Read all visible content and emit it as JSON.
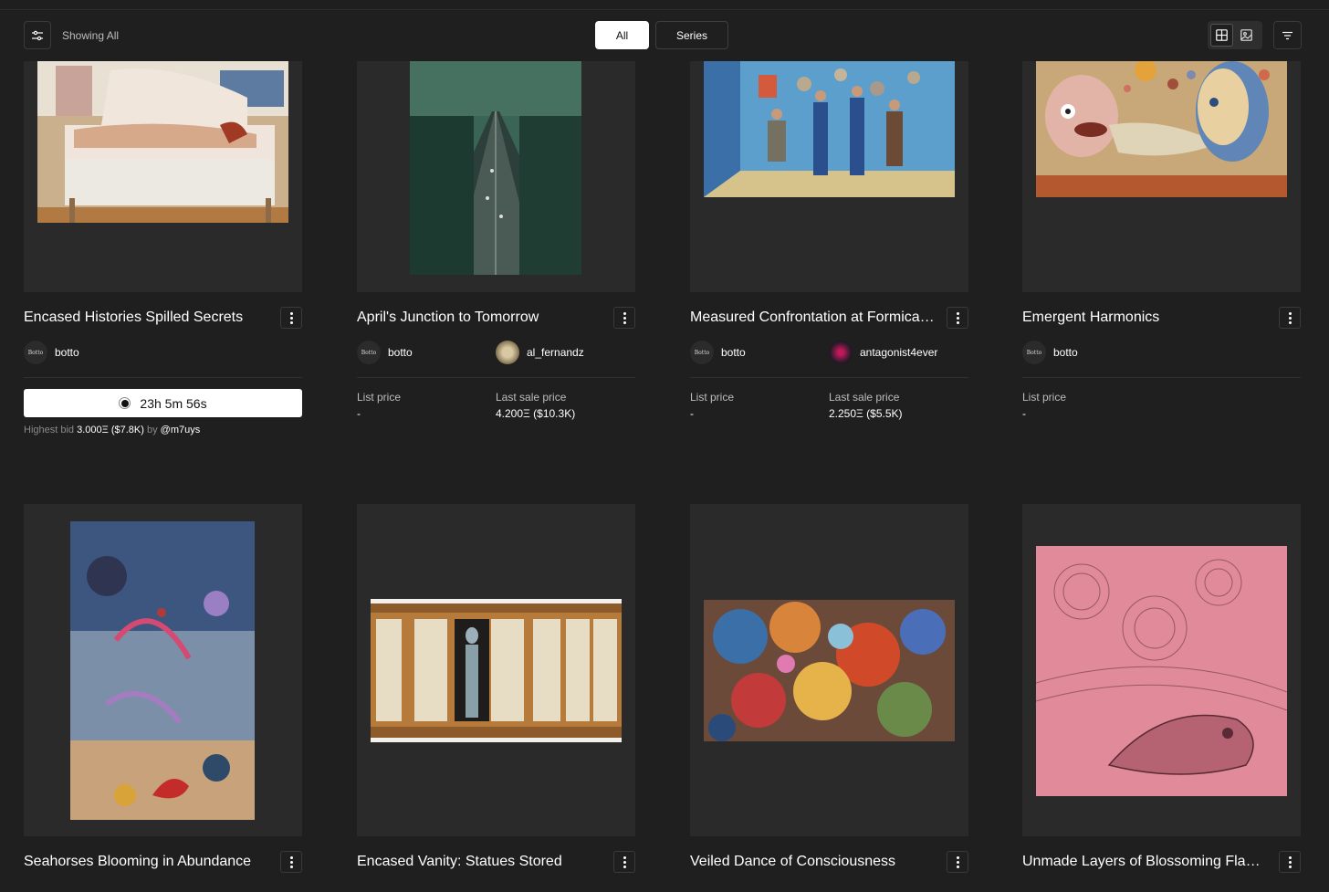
{
  "toolbar": {
    "showing_label": "Showing All",
    "tabs": [
      {
        "label": "All",
        "active": true
      },
      {
        "label": "Series",
        "active": false
      }
    ],
    "view_modes": [
      "grid-view-icon",
      "image-view-icon"
    ],
    "active_view": "grid-view-icon"
  },
  "cards": [
    {
      "title": "Encased Histories Spilled Secrets",
      "artist": {
        "name": "botto",
        "avatar_text": "Botto"
      },
      "auction": {
        "countdown": "23h 5m 56s",
        "bid_label": "Highest bid",
        "bid_value": "3.000Ξ ($7.8K)",
        "by_label": "by",
        "bidder": "@m7uys"
      }
    },
    {
      "title": "April's Junction to Tomorrow",
      "artist": {
        "name": "botto",
        "avatar_text": "Botto"
      },
      "owner": {
        "name": "al_fernandz"
      },
      "list_price_label": "List price",
      "list_price": "-",
      "last_sale_label": "Last sale price",
      "last_sale": "4.200Ξ ($10.3K)"
    },
    {
      "title": "Measured Confrontation at Formica F...",
      "artist": {
        "name": "botto",
        "avatar_text": "Botto"
      },
      "owner": {
        "name": "antagonist4ever"
      },
      "list_price_label": "List price",
      "list_price": "-",
      "last_sale_label": "Last sale price",
      "last_sale": "2.250Ξ ($5.5K)"
    },
    {
      "title": "Emergent Harmonics",
      "artist": {
        "name": "botto",
        "avatar_text": "Botto"
      },
      "list_price_label": "List price",
      "list_price": "-"
    },
    {
      "title": "Seahorses Blooming in Abundance"
    },
    {
      "title": "Encased Vanity: Statues Stored"
    },
    {
      "title": "Veiled Dance of Consciousness"
    },
    {
      "title": "Unmade Layers of Blossoming Flami..."
    }
  ],
  "colors": {
    "background": "#1f1f1f",
    "card": "#2a2a2a",
    "text": "#ffffff",
    "muted": "#bdbdbd"
  }
}
